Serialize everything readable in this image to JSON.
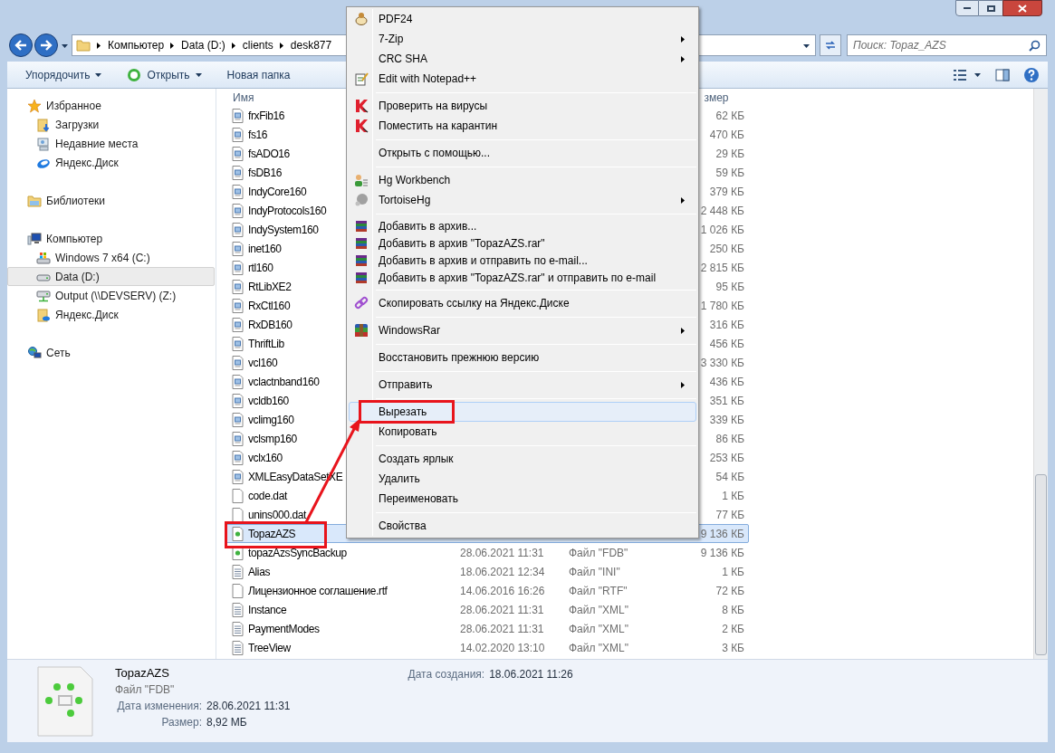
{
  "address_bar": {
    "path": [
      "Компьютер",
      "Data (D:)",
      "clients",
      "desk877"
    ]
  },
  "search": {
    "placeholder": "Поиск: Topaz_AZS"
  },
  "toolbar": [
    {
      "label": "Упорядочить",
      "kind": "menu"
    },
    {
      "label": "Открыть",
      "kind": "open"
    },
    {
      "label": "Новая папка",
      "kind": "plain"
    }
  ],
  "sidebar": {
    "groups": [
      {
        "label": "Избранное",
        "kind": "star",
        "selected": false,
        "children": [
          {
            "label": "Загрузки",
            "kind": "downloads",
            "selected": false
          },
          {
            "label": "Недавние места",
            "kind": "recent",
            "selected": false
          },
          {
            "label": "Яндекс.Диск",
            "kind": "disk",
            "selected": false
          }
        ]
      },
      {
        "label": "Библиотеки",
        "kind": "library",
        "selected": false
      },
      {
        "label": "Компьютер",
        "kind": "computer",
        "selected": false,
        "children": [
          {
            "label": "Windows 7 x64 (C:)",
            "kind": "windrive",
            "selected": false
          },
          {
            "label": "Data (D:)",
            "kind": "drive",
            "selected": true
          },
          {
            "label": "Output (\\\\DEVSERV) (Z:)",
            "kind": "netdrive",
            "selected": false
          },
          {
            "label": "Яндекс.Диск",
            "kind": "diskfolder",
            "selected": false
          }
        ]
      },
      {
        "label": "Сеть",
        "kind": "network",
        "selected": false
      }
    ]
  },
  "columns": {
    "name": "Имя",
    "column_4": "змер"
  },
  "files": [
    {
      "name": "frxFib16",
      "kind": "dll",
      "size": "62 КБ",
      "selected": false
    },
    {
      "name": "fs16",
      "kind": "dll",
      "size": "470 КБ",
      "selected": false
    },
    {
      "name": "fsADO16",
      "kind": "dll",
      "size": "29 КБ",
      "selected": false
    },
    {
      "name": "fsDB16",
      "kind": "dll",
      "size": "59 КБ",
      "selected": false
    },
    {
      "name": "IndyCore160",
      "kind": "dll",
      "size": "379 КБ",
      "selected": false
    },
    {
      "name": "IndyProtocols160",
      "kind": "dll",
      "size": "2 448 КБ",
      "selected": false
    },
    {
      "name": "IndySystem160",
      "kind": "dll",
      "size": "1 026 КБ",
      "selected": false
    },
    {
      "name": "inet160",
      "kind": "dll",
      "size": "250 КБ",
      "selected": false
    },
    {
      "name": "rtl160",
      "kind": "dll",
      "size": "2 815 КБ",
      "selected": false
    },
    {
      "name": "RtLibXE2",
      "kind": "dll",
      "size": "95 КБ",
      "selected": false
    },
    {
      "name": "RxCtl160",
      "kind": "dll",
      "size": "1 780 КБ",
      "selected": false
    },
    {
      "name": "RxDB160",
      "kind": "dll",
      "size": "316 КБ",
      "selected": false
    },
    {
      "name": "ThriftLib",
      "kind": "dll",
      "size": "456 КБ",
      "selected": false
    },
    {
      "name": "vcl160",
      "kind": "dll",
      "size": "3 330 КБ",
      "selected": false
    },
    {
      "name": "vclactnband160",
      "kind": "dll",
      "size": "436 КБ",
      "selected": false
    },
    {
      "name": "vcldb160",
      "kind": "dll",
      "size": "351 КБ",
      "selected": false
    },
    {
      "name": "vclimg160",
      "kind": "dll",
      "size": "339 КБ",
      "selected": false
    },
    {
      "name": "vclsmp160",
      "kind": "dll",
      "size": "86 КБ",
      "selected": false
    },
    {
      "name": "vclx160",
      "kind": "dll",
      "size": "253 КБ",
      "selected": false
    },
    {
      "name": "XMLEasyDataSetXE",
      "kind": "dll",
      "size": "54 КБ",
      "selected": false
    },
    {
      "name": "code.dat",
      "kind": "blank",
      "size": "1 КБ",
      "selected": false
    },
    {
      "name": "unins000.dat",
      "kind": "blank",
      "size": "77 КБ",
      "selected": false
    },
    {
      "name": "TopazAZS",
      "kind": "fdb",
      "size": "9 136 КБ",
      "selected": true
    },
    {
      "name": "topazAzsSyncBackup",
      "kind": "fdb",
      "date": "28.06.2021 11:31",
      "type": "Файл \"FDB\"",
      "size": "9 136 КБ",
      "selected": false
    },
    {
      "name": "Alias",
      "kind": "text",
      "date": "18.06.2021 12:34",
      "type": "Файл \"INI\"",
      "size": "1 КБ",
      "selected": false
    },
    {
      "name": "Лицензионное соглашение.rtf",
      "kind": "blank",
      "date": "14.06.2016 16:26",
      "type": "Файл \"RTF\"",
      "size": "72 КБ",
      "selected": false
    },
    {
      "name": "Instance",
      "kind": "text",
      "date": "28.06.2021 11:31",
      "type": "Файл \"XML\"",
      "size": "8 КБ",
      "selected": false
    },
    {
      "name": "PaymentModes",
      "kind": "text",
      "date": "28.06.2021 11:31",
      "type": "Файл \"XML\"",
      "size": "2 КБ",
      "selected": false
    },
    {
      "name": "TreeView",
      "kind": "text",
      "date": "14.02.2020 13:10",
      "type": "Файл \"XML\"",
      "size": "3 КБ",
      "selected": false
    }
  ],
  "context_menu": {
    "groups": [
      [
        {
          "label": "PDF24",
          "kind": "pdf",
          "submenu": false,
          "selected": false
        },
        {
          "label": "7-Zip",
          "kind": "none",
          "submenu": true,
          "selected": false
        },
        {
          "label": "CRC SHA",
          "kind": "none",
          "submenu": true,
          "selected": false
        },
        {
          "label": "Edit with Notepad++",
          "kind": "notepad",
          "submenu": false,
          "selected": false
        }
      ],
      [
        {
          "label": "Проверить на вирусы",
          "kind": "antivirus",
          "submenu": false,
          "selected": false
        },
        {
          "label": "Поместить на карантин",
          "kind": "antivirus",
          "submenu": false,
          "selected": false
        }
      ],
      [
        {
          "label": "Открыть с помощью...",
          "kind": "none",
          "submenu": false,
          "selected": false
        }
      ],
      [
        {
          "label": "Hg Workbench",
          "kind": "workbench",
          "submenu": false,
          "selected": false
        },
        {
          "label": "TortoiseHg",
          "kind": "tortoise",
          "submenu": true,
          "selected": false
        }
      ],
      [
        {
          "label": "Добавить в архив...",
          "kind": "rar",
          "submenu": false,
          "selected": false
        },
        {
          "label": "Добавить в архив \"TopazAZS.rar\"",
          "kind": "rar",
          "submenu": false,
          "selected": false
        },
        {
          "label": "Добавить в архив и отправить по e-mail...",
          "kind": "rar",
          "submenu": false,
          "selected": false
        },
        {
          "label": "Добавить в архив \"TopazAZS.rar\" и отправить по e-mail",
          "kind": "rar",
          "submenu": false,
          "selected": false
        }
      ],
      [
        {
          "label": "Скопировать ссылку на Яндекс.Диске",
          "kind": "link",
          "submenu": false,
          "selected": false
        }
      ],
      [
        {
          "label": "WindowsRar",
          "kind": "winrar",
          "submenu": true,
          "selected": false
        }
      ],
      [
        {
          "label": "Восстановить прежнюю версию",
          "kind": "none",
          "submenu": false,
          "selected": false
        }
      ],
      [
        {
          "label": "Отправить",
          "kind": "none",
          "submenu": true,
          "selected": false
        }
      ],
      [
        {
          "label": "Вырезать",
          "kind": "none",
          "submenu": false,
          "selected": true
        },
        {
          "label": "Копировать",
          "kind": "none",
          "submenu": false,
          "selected": false
        }
      ],
      [
        {
          "label": "Создать ярлык",
          "kind": "none",
          "submenu": false,
          "selected": false
        },
        {
          "label": "Удалить",
          "kind": "none",
          "submenu": false,
          "selected": false
        },
        {
          "label": "Переименовать",
          "kind": "none",
          "submenu": false,
          "selected": false
        }
      ],
      [
        {
          "label": "Свойства",
          "kind": "none",
          "submenu": false,
          "selected": false
        }
      ]
    ]
  },
  "details": {
    "name": "TopazAZS",
    "type": "Файл \"FDB\"",
    "fields": [
      {
        "label": "Дата изменения:",
        "value": "28.06.2021 11:31"
      },
      {
        "label": "Размер:",
        "value": "8,92 МБ"
      }
    ],
    "created": {
      "label": "Дата создания:",
      "value": "18.06.2021 11:26"
    }
  }
}
